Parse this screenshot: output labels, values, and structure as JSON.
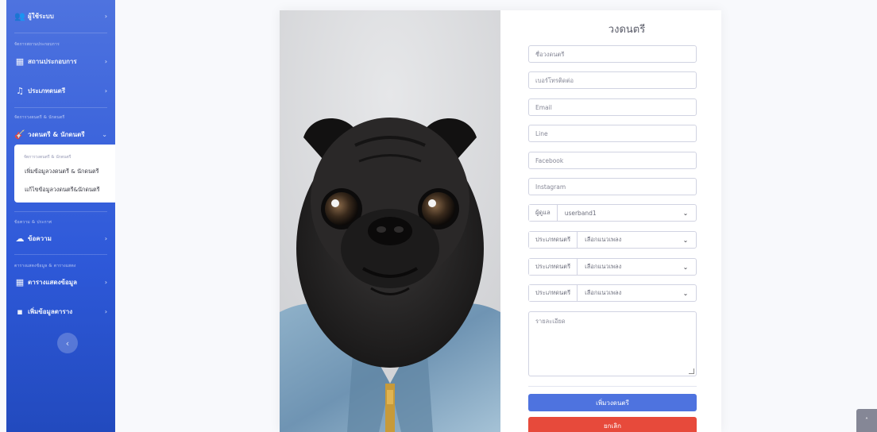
{
  "sidebar": {
    "items": [
      {
        "label": "ผู้ใช้ระบบ",
        "icon": "users-cog-icon",
        "glyph": "👥",
        "chevron": "›"
      },
      {
        "label": "สถานประกอบการ",
        "icon": "store-icon",
        "glyph": "▦",
        "chevron": "›"
      },
      {
        "label": "ประเภทดนตรี",
        "icon": "music-icon",
        "glyph": "♫",
        "chevron": "›"
      },
      {
        "label": "วงดนตรี & นักดนตรี",
        "icon": "guitar-icon",
        "glyph": "🎸",
        "chevron": "⌄"
      },
      {
        "label": "ข้อความ",
        "icon": "comments-icon",
        "glyph": "☁",
        "chevron": "›"
      },
      {
        "label": "ตารางแสดงข้อมูล",
        "icon": "table-icon",
        "glyph": "▦",
        "chevron": "›"
      },
      {
        "label": "เพิ่มข้อมูลตาราง",
        "icon": "folder-plus-icon",
        "glyph": "▪",
        "chevron": "›"
      }
    ],
    "headings": {
      "venue": "จัดการสถานประกอบการ",
      "band": "จัดการวงดนตรี & นักดนตรี",
      "message": "ข้อความ & ประกาศ",
      "table": "ตารางแสดงข้อมูล & ตารางแสดง"
    },
    "submenu": {
      "heading": "จัดการวงดนตรี & นักดนตรี",
      "links": [
        "เพิ่มข้อมูลวงดนตรี & นักดนตรี",
        "แก้ไขข้อมูลวงดนตรี&นักดนตรี"
      ]
    },
    "toggle_glyph": "‹"
  },
  "form": {
    "title": "วงดนตรี",
    "placeholders": {
      "band_name": "ชื่อวงดนตรี",
      "phone": "เบอร์โทรติดต่อ",
      "email": "Email",
      "line": "Line",
      "facebook": "Facebook",
      "instagram": "Instagram",
      "details": "รายละเอียด"
    },
    "owner": {
      "label": "ผู้ดูแล",
      "value": "userband1"
    },
    "genres": [
      {
        "label": "ประเภทดนตรี",
        "value": "เลือกแนวเพลง"
      },
      {
        "label": "ประเภทดนตรี",
        "value": "เลือกแนวเพลง"
      },
      {
        "label": "ประเภทดนตรี",
        "value": "เลือกแนวเพลง"
      }
    ],
    "submit_label": "เพิ่มวงดนตรี",
    "cancel_label": "ยกเลิก",
    "chevron": "⌄"
  },
  "scroll_top_glyph": "˄",
  "colors": {
    "sidebar": "#4e73df",
    "primary": "#4e73df",
    "danger": "#e74a3b",
    "scroll_top": "#858796"
  }
}
